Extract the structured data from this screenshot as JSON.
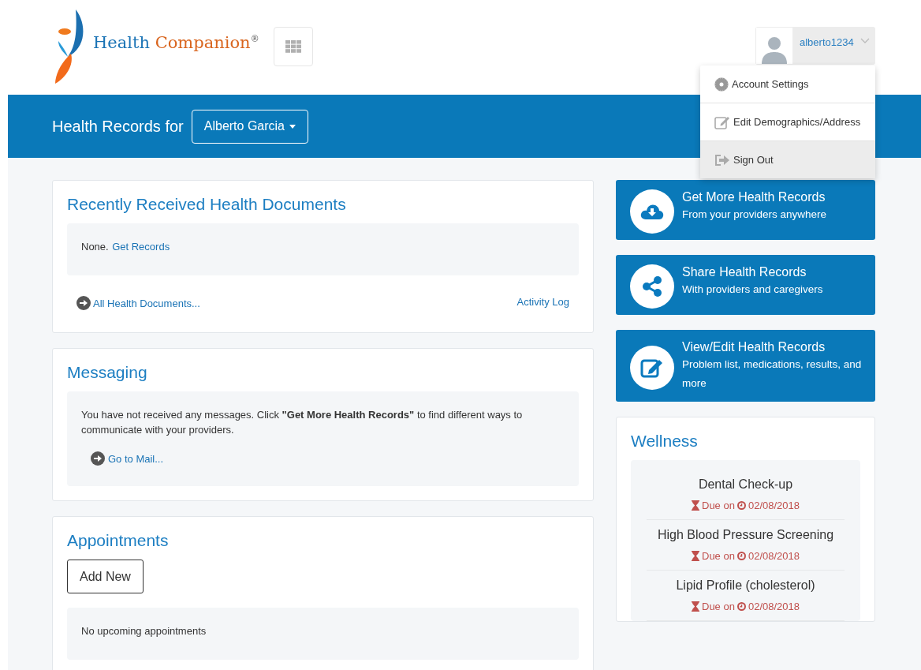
{
  "logo": {
    "word_1": "Health",
    "word_2": "Companion",
    "mark": "®"
  },
  "user": {
    "name": "alberto1234"
  },
  "user_menu": [
    {
      "kind": "settings",
      "label": "Account Settings",
      "selected": false
    },
    {
      "kind": "edit",
      "label": "Edit Demographics/Address",
      "selected": false
    },
    {
      "kind": "signout",
      "label": "Sign Out",
      "selected": true
    }
  ],
  "banner": {
    "title": "Health Records for",
    "patient": "Alberto Garcia"
  },
  "documents": {
    "title": "Recently Received Health Documents",
    "empty_text": "None.",
    "get_link": "Get Records",
    "all_link": "All Health Documents...",
    "log_link": "Activity Log"
  },
  "messaging": {
    "title": "Messaging",
    "text": "You have not received any messages. Click **\"Get More Health Records\"** to find different ways to communicate with your providers.",
    "mail_link": "Go to Mail..."
  },
  "appointments": {
    "title": "Appointments",
    "add_button": "Add New",
    "empty_text": "No upcoming appointments"
  },
  "actions": [
    {
      "kind": "download",
      "title": "Get More Health Records",
      "subtitle": "From your providers anywhere"
    },
    {
      "kind": "share",
      "title": "Share Health Records",
      "subtitle": "With providers and caregivers"
    },
    {
      "kind": "edit",
      "title": "View/Edit Health Records",
      "subtitle": "Problem list, medications, results, and more"
    }
  ],
  "wellness": {
    "title": "Wellness",
    "items": [
      {
        "name": "Dental Check-up",
        "due_label": "Due on",
        "date": "02/08/2018"
      },
      {
        "name": "High Blood Pressure Screening",
        "due_label": "Due on",
        "date": "02/08/2018"
      },
      {
        "name": "Lipid Profile (cholesterol)",
        "due_label": "Due on",
        "date": "02/08/2018"
      }
    ]
  }
}
